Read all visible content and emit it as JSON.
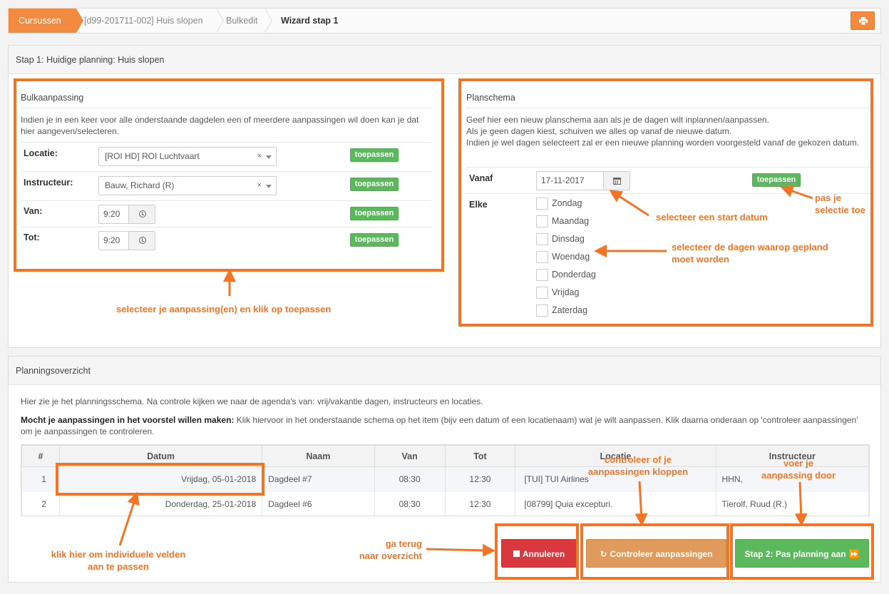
{
  "breadcrumb": {
    "home": "Cursussen",
    "course": "[d99-201711-002] Huis slopen",
    "bulkedit": "Bulkedit",
    "current": "Wizard stap 1"
  },
  "step_panel": {
    "title": "Stap 1: Huidige planning: Huis slopen"
  },
  "bulk": {
    "title": "Bulkaanpassing",
    "description": "Indien je in een keer voor alle onderstaande dagdelen een of meerdere aanpassingen wil doen kan je dat hier aangeven/selecteren.",
    "locatie_label": "Locatie:",
    "locatie_value": "[ROI HD] ROI Luchtvaart",
    "instructeur_label": "Instructeur:",
    "instructeur_value": "Bauw, Richard (R)",
    "van_label": "Van:",
    "van_value": "9:20",
    "tot_label": "Tot:",
    "tot_value": "9:20",
    "apply_label": "toepassen",
    "clear_symbol": "×"
  },
  "planschema": {
    "title": "Planschema",
    "line1": "Geef hier een nieuw planschema aan als je de dagen wilt inplannen/aanpassen.",
    "line2": "Als je geen dagen kiest, schuiven we alles op vanaf de nieuwe datum.",
    "line3": "Indien je wel dagen selecteert zal er een nieuwe planning worden voorgesteld vanaf de gekozen datum.",
    "vanaf_label": "Vanaf",
    "vanaf_value": "17-11-2017",
    "elke_label": "Elke",
    "apply_label": "toepassen",
    "days": [
      "Zondag",
      "Maandag",
      "Dinsdag",
      "Woendag",
      "Donderdag",
      "Vrijdag",
      "Zaterdag"
    ]
  },
  "overview": {
    "title": "Planningsoverzicht",
    "intro": "Hier zie je het planningsschema. Na controle kijken we naar de agenda's van: vrij/vakantie dagen, instructeurs en locaties.",
    "bold": "Mocht je aanpassingen in het voorstel willen maken:",
    "instructions": " Klik hiervoor in het onderstaande schema op het item (bijv een datum of een locatienaam) wat je wilt aanpassen. Klik daarna onderaan op 'controleer aanpassingen' om je aanpassingen te controleren.",
    "columns": [
      "#",
      "Datum",
      "Naam",
      "Van",
      "Tot",
      "Locatie",
      "Instructeur"
    ],
    "rows": [
      {
        "num": "1",
        "datum": "Vrijdag, 05-01-2018",
        "naam": "Dagdeel #7",
        "van": "08:30",
        "tot": "12:30",
        "locatie": "[TUI] TUI Airlines",
        "instructeur": "HHN,"
      },
      {
        "num": "2",
        "datum": "Donderdag, 25-01-2018",
        "naam": "Dagdeel #6",
        "van": "08:30",
        "tot": "12:30",
        "locatie": "[08799] Quia excepturi.",
        "instructeur": "Tierolf, Ruud (R.)"
      }
    ]
  },
  "actions": {
    "cancel": "Annuleren",
    "check": "Controleer aanpassingen",
    "next": "Stap 2: Pas planning aan"
  },
  "annotations": {
    "bulk": "selecteer je aanpassing(en) en klik op toepassen",
    "start_date": "selecteer een start datum",
    "apply_line1": "pas je",
    "apply_line2": "selectie toe",
    "days_line1": "selecteer de dagen waarop gepland",
    "days_line2": "moet worden",
    "edit_line1": "klik hier om individuele velden",
    "edit_line2": "aan te passen",
    "back_line1": "ga terug",
    "back_line2": "naar overzicht",
    "check_line1": "controleer of je",
    "check_line2": "aanpassingen kloppen",
    "run_line1": "voer je",
    "run_line2": "aanpassing door"
  },
  "colors": {
    "accent": "#f28a40",
    "annotation": "#f47425",
    "green": "#5cb85c",
    "danger": "#d9383e"
  }
}
